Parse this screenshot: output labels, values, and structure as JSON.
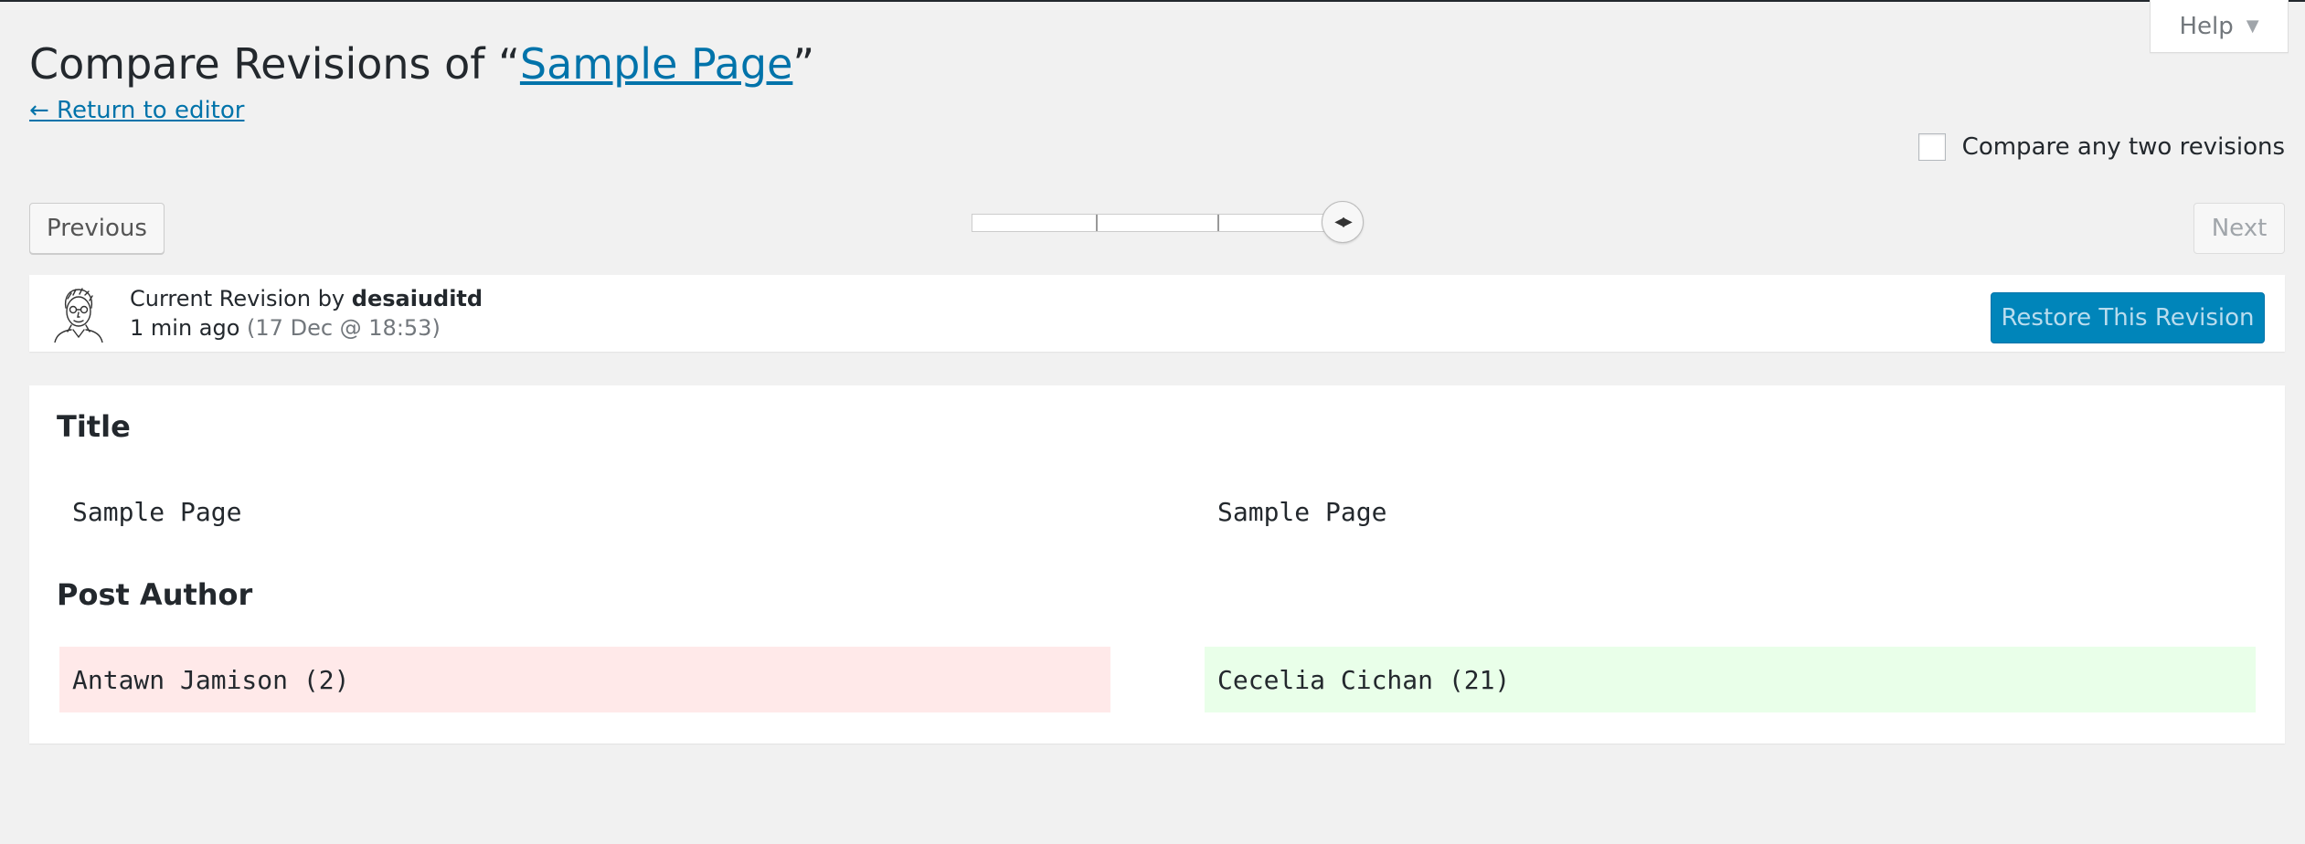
{
  "help": {
    "label": "Help",
    "arrow_icon": "triangle-down-icon"
  },
  "header": {
    "title_prefix": "Compare Revisions of “",
    "title_link": "Sample Page",
    "title_suffix": "”",
    "return_link": "← Return to editor"
  },
  "compare_two": {
    "label": "Compare any two revisions",
    "checked": false
  },
  "nav": {
    "previous_label": "Previous",
    "next_label": "Next",
    "slider_icon": "slider-handle-icon",
    "slider_handle_glyph": "◀▶"
  },
  "revision_meta": {
    "prefix": "Current Revision by ",
    "author": "desaiuditd",
    "time_ago": "1 min ago",
    "date": " (17 Dec @ 18:53)",
    "restore_label": "Restore This Revision"
  },
  "diff": {
    "sections": [
      {
        "heading": "Title",
        "left": "Sample Page",
        "right": "Sample Page"
      },
      {
        "heading": "Post Author",
        "left": "Antawn Jamison (2)",
        "right": "Cecelia Cichan (21)"
      }
    ]
  },
  "colors": {
    "link": "#0073aa",
    "primary_button": "#0085ba",
    "removed_bg": "#ffe9e9",
    "added_bg": "#e9ffe9",
    "page_bg": "#f1f1f1"
  }
}
